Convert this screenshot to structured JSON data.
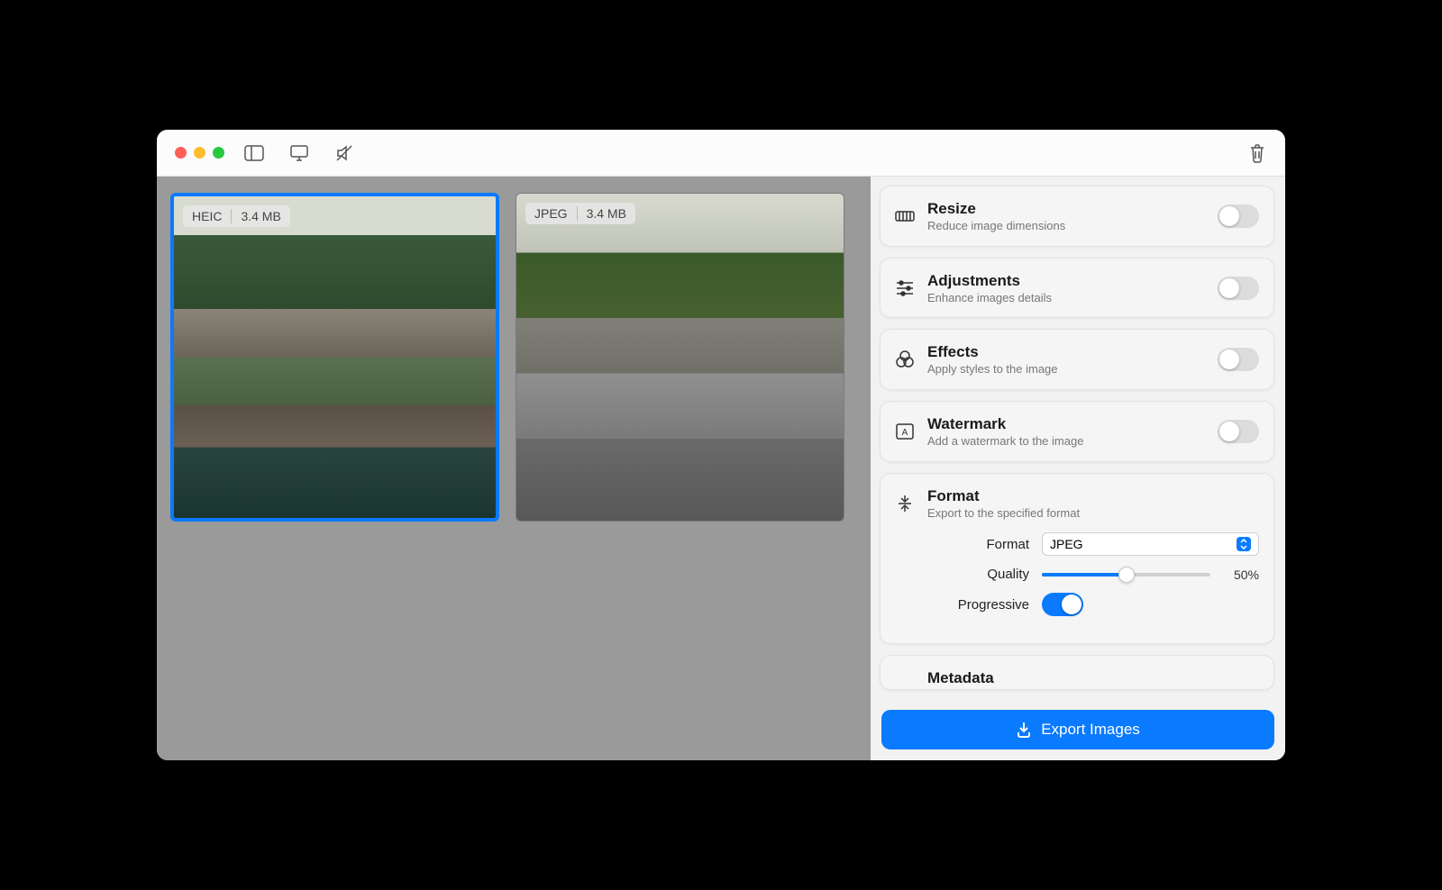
{
  "images": [
    {
      "format": "HEIC",
      "size": "3.4 MB",
      "selected": true
    },
    {
      "format": "JPEG",
      "size": "3.4 MB",
      "selected": false
    }
  ],
  "panels": {
    "resize": {
      "title": "Resize",
      "sub": "Reduce image dimensions",
      "on": false
    },
    "adjustments": {
      "title": "Adjustments",
      "sub": "Enhance images details",
      "on": false
    },
    "effects": {
      "title": "Effects",
      "sub": "Apply styles to the image",
      "on": false
    },
    "watermark": {
      "title": "Watermark",
      "sub": "Add a watermark to the image",
      "on": false
    },
    "format": {
      "title": "Format",
      "sub": "Export to the specified format"
    },
    "metadata": {
      "title": "Metadata"
    }
  },
  "format": {
    "label_format": "Format",
    "value_format": "JPEG",
    "label_quality": "Quality",
    "value_quality": 50,
    "value_quality_display": "50%",
    "label_progressive": "Progressive",
    "progressive_on": true
  },
  "export_label": "Export Images"
}
